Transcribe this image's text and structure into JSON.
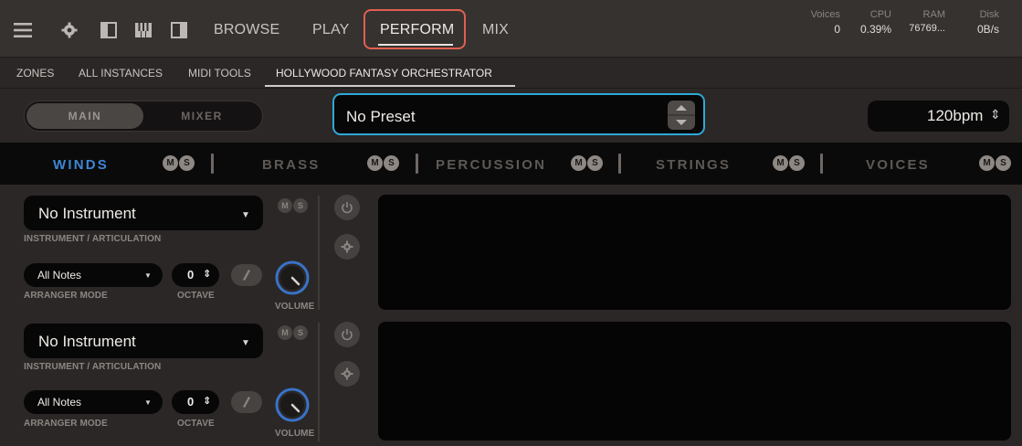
{
  "topbar": {
    "nav": [
      "BROWSE",
      "PLAY",
      "PERFORM",
      "MIX"
    ],
    "active_nav": "PERFORM",
    "stats": [
      {
        "label": "Voices",
        "value": "0"
      },
      {
        "label": "CPU",
        "value": "0.39%"
      },
      {
        "label": "RAM",
        "value": "76769..."
      },
      {
        "label": "Disk",
        "value": "0B/s"
      }
    ]
  },
  "subtabs": [
    "ZONES",
    "ALL INSTANCES",
    "MIDI TOOLS",
    "HOLLYWOOD FANTASY ORCHESTRATOR"
  ],
  "controls": {
    "main_label": "MAIN",
    "mixer_label": "MIXER",
    "preset": "No Preset",
    "tempo": "120bpm",
    "tempo_arrows": "⇕"
  },
  "sections": [
    {
      "label": "WINDS",
      "mute": "M",
      "solo": "S",
      "active": true
    },
    {
      "label": "BRASS",
      "mute": "M",
      "solo": "S"
    },
    {
      "label": "PERCUSSION",
      "mute": "M",
      "solo": "S"
    },
    {
      "label": "STRINGS",
      "mute": "M",
      "solo": "S"
    },
    {
      "label": "VOICES",
      "mute": "M",
      "solo": "S"
    }
  ],
  "slots": [
    {
      "instrument": "No Instrument",
      "instrument_caption": "INSTRUMENT / ARTICULATION",
      "arranger": "All Notes",
      "arranger_caption": "ARRANGER MODE",
      "octave": "0",
      "octave_caption": "OCTAVE",
      "volume_caption": "VOLUME",
      "mute": "M",
      "solo": "S"
    },
    {
      "instrument": "No Instrument",
      "instrument_caption": "INSTRUMENT / ARTICULATION",
      "arranger": "All Notes",
      "arranger_caption": "ARRANGER MODE",
      "octave": "0",
      "octave_caption": "OCTAVE",
      "volume_caption": "VOLUME",
      "mute": "M",
      "solo": "S"
    }
  ],
  "colors": {
    "accent_blue": "#3d86d6",
    "highlight_red": "#e06050",
    "preset_border": "#2fa8d8"
  }
}
